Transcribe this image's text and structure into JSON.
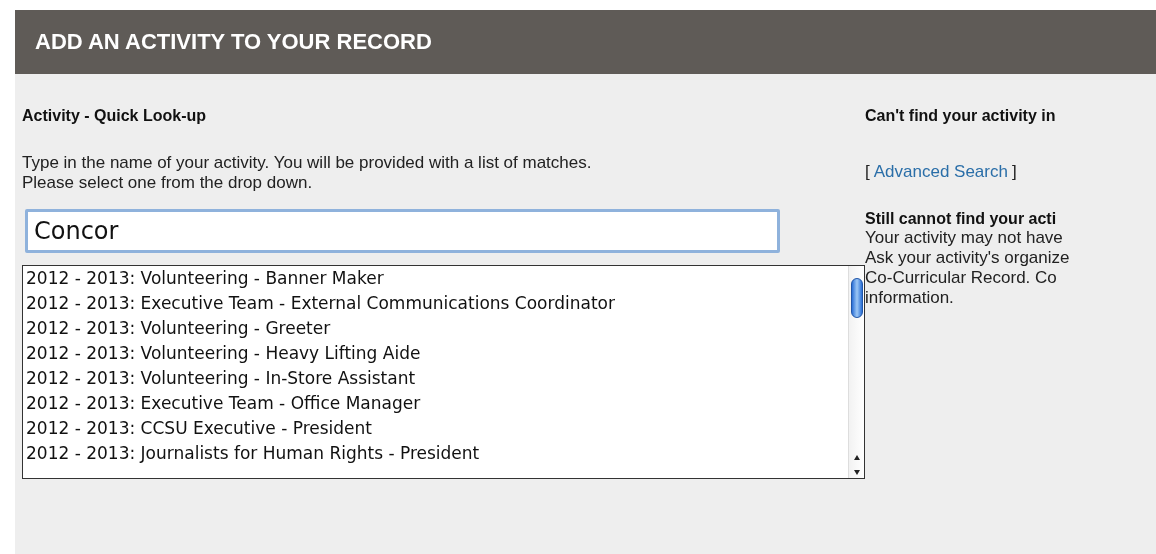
{
  "header": {
    "title": "ADD AN ACTIVITY TO YOUR RECORD"
  },
  "lookup": {
    "heading": "Activity - Quick Look-up",
    "instructions": [
      "Type in the name of your activity. You will be provided with a list of matches.",
      "Please select one from the drop down."
    ],
    "value": "Concor",
    "matches": [
      {
        "label": "2012 - 2013: Volunteering - Banner Maker",
        "selected": false
      },
      {
        "label": "2012 - 2013: Executive Team - External Communications Coordinator",
        "selected": false
      },
      {
        "label": "2012 - 2013: Volunteering - Greeter",
        "selected": false
      },
      {
        "label": "2012 - 2013: Volunteering - Heavy Lifting Aide",
        "selected": false
      },
      {
        "label": "2012 - 2013: Volunteering - In-Store Assistant",
        "selected": false
      },
      {
        "label": "2012 - 2013: Executive Team - Office Manager",
        "selected": false
      },
      {
        "label": "2012 - 2013: CCSU Executive - President",
        "selected": false
      },
      {
        "label": "2012 - 2013: Journalists for Human Rights - President",
        "selected": false
      }
    ]
  },
  "help": {
    "heading": "Can't find your activity in",
    "link_open": "[",
    "link": "Advanced Search",
    "link_close": "]",
    "subheading": "Still cannot find your acti",
    "lines": [
      "Your activity may not have",
      "Ask your activity's organize",
      "Co-Curricular Record. Co",
      "information."
    ]
  }
}
